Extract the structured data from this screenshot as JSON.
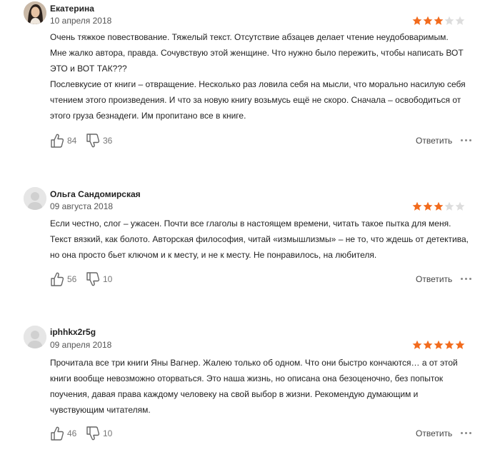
{
  "reviews": [
    {
      "author": "Екатерина",
      "date": "10 апреля 2018",
      "rating": 3,
      "max_rating": 5,
      "lines": [
        "Очень тяжкое повествование. Тяжелый текст. Отсутствие абзацев делает чтение неудобоваримым.",
        "Мне жалко автора, правда. Сочувствую этой женщине. Что нужно было пережить, чтобы написать ВОТ",
        "ЭТО и ВОТ ТАК???",
        "Послевкусие от книги – отвращение. Несколько раз ловила себя на мысли, что морально насилую себя",
        "чтением этого произведения. И что за новую книгу возьмусь ещё не скоро. Сначала – освободиться от",
        "этого груза безнадеги. Им пропитано все в книге."
      ],
      "likes": "84",
      "dislikes": "36",
      "reply_label": "Ответить"
    },
    {
      "author": "Ольга Сандомирская",
      "date": "09 августа 2018",
      "rating": 3,
      "max_rating": 5,
      "lines": [
        "Если честно, слог – ужасен. Почти все глаголы в настоящем времени, читать такое пытка для меня.",
        "Текст вязкий, как болото. Авторская философия, читай «измышлизмы» – не то, что ждешь от детектива,",
        "но она просто бьет ключом и к месту, и не к месту. Не понравилось, на любителя."
      ],
      "likes": "56",
      "dislikes": "10",
      "reply_label": "Ответить"
    },
    {
      "author": "iphhkx2r5g",
      "date": "09 апреля 2018",
      "rating": 5,
      "max_rating": 5,
      "lines": [
        "Прочитала все три книги Яны Вагнер. Жалею только об одном. Что они быстро кончаются… а от этой",
        "книги вообще невозможно оторваться. Это наша жизнь, но описана она безоценочно, без попыток",
        "поучения, давая права каждому человеку на свой выбор в жизни. Рекомендую думающим и",
        "чувствующим читателям."
      ],
      "likes": "46",
      "dislikes": "10",
      "reply_label": "Ответить"
    }
  ],
  "colors": {
    "star_filled": "#f26b1d",
    "star_empty": "#dddddd",
    "text": "#222222",
    "muted": "#777777"
  }
}
